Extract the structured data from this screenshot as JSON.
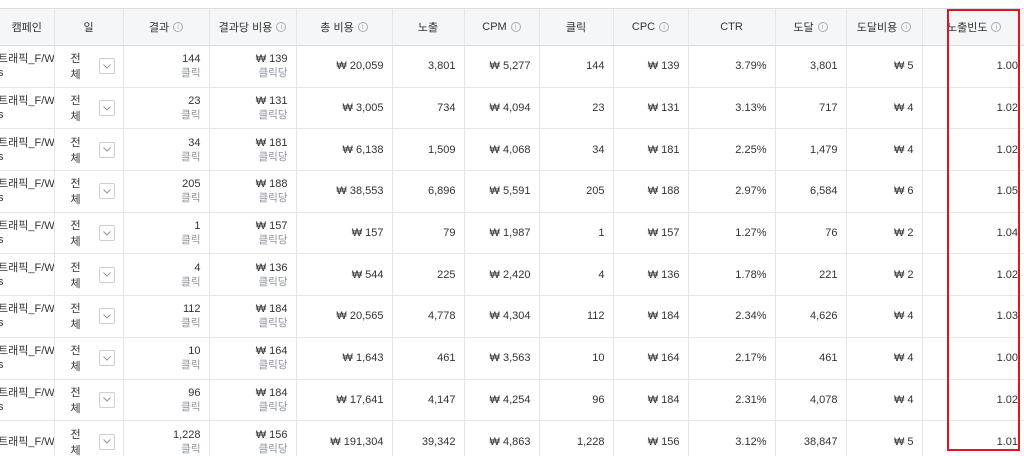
{
  "columns": [
    {
      "label": "캠페인",
      "info": false
    },
    {
      "label": "일",
      "info": false
    },
    {
      "label": "결과",
      "info": true
    },
    {
      "label": "결과당 비용",
      "info": true
    },
    {
      "label": "총 비용",
      "info": true
    },
    {
      "label": "노출",
      "info": false
    },
    {
      "label": "CPM",
      "info": true
    },
    {
      "label": "클릭",
      "info": false
    },
    {
      "label": "CPC",
      "info": true
    },
    {
      "label": "CTR",
      "info": false
    },
    {
      "label": "도달",
      "info": true
    },
    {
      "label": "도달비용",
      "info": true
    },
    {
      "label": "노출빈도",
      "info": true
    }
  ],
  "info_glyph": "i",
  "day_select_value": "전체",
  "result_unit": "클릭",
  "cost_per_result_unit": "클릭당",
  "rows": [
    {
      "campaign": "트래픽_F/W",
      "campaign_sub": "s",
      "results": "144",
      "cost_per_result": "₩ 139",
      "total_cost": "₩ 20,059",
      "impressions": "3,801",
      "cpm": "₩ 5,277",
      "clicks": "144",
      "cpc": "₩ 139",
      "ctr": "3.79%",
      "reach": "3,801",
      "reach_cost": "₩ 5",
      "frequency": "1.00"
    },
    {
      "campaign": "트래픽_F/W",
      "campaign_sub": "s",
      "results": "23",
      "cost_per_result": "₩ 131",
      "total_cost": "₩ 3,005",
      "impressions": "734",
      "cpm": "₩ 4,094",
      "clicks": "23",
      "cpc": "₩ 131",
      "ctr": "3.13%",
      "reach": "717",
      "reach_cost": "₩ 4",
      "frequency": "1.02"
    },
    {
      "campaign": "트래픽_F/W",
      "campaign_sub": "s",
      "results": "34",
      "cost_per_result": "₩ 181",
      "total_cost": "₩ 6,138",
      "impressions": "1,509",
      "cpm": "₩ 4,068",
      "clicks": "34",
      "cpc": "₩ 181",
      "ctr": "2.25%",
      "reach": "1,479",
      "reach_cost": "₩ 4",
      "frequency": "1.02"
    },
    {
      "campaign": "트래픽_F/W",
      "campaign_sub": "s",
      "results": "205",
      "cost_per_result": "₩ 188",
      "total_cost": "₩ 38,553",
      "impressions": "6,896",
      "cpm": "₩ 5,591",
      "clicks": "205",
      "cpc": "₩ 188",
      "ctr": "2.97%",
      "reach": "6,584",
      "reach_cost": "₩ 6",
      "frequency": "1.05"
    },
    {
      "campaign": "트래픽_F/W",
      "campaign_sub": "s",
      "results": "1",
      "cost_per_result": "₩ 157",
      "total_cost": "₩ 157",
      "impressions": "79",
      "cpm": "₩ 1,987",
      "clicks": "1",
      "cpc": "₩ 157",
      "ctr": "1.27%",
      "reach": "76",
      "reach_cost": "₩ 2",
      "frequency": "1.04"
    },
    {
      "campaign": "트래픽_F/W",
      "campaign_sub": "s",
      "results": "4",
      "cost_per_result": "₩ 136",
      "total_cost": "₩ 544",
      "impressions": "225",
      "cpm": "₩ 2,420",
      "clicks": "4",
      "cpc": "₩ 136",
      "ctr": "1.78%",
      "reach": "221",
      "reach_cost": "₩ 2",
      "frequency": "1.02"
    },
    {
      "campaign": "트래픽_F/W",
      "campaign_sub": "s",
      "results": "112",
      "cost_per_result": "₩ 184",
      "total_cost": "₩ 20,565",
      "impressions": "4,778",
      "cpm": "₩ 4,304",
      "clicks": "112",
      "cpc": "₩ 184",
      "ctr": "2.34%",
      "reach": "4,626",
      "reach_cost": "₩ 4",
      "frequency": "1.03"
    },
    {
      "campaign": "트래픽_F/W",
      "campaign_sub": "s",
      "results": "10",
      "cost_per_result": "₩ 164",
      "total_cost": "₩ 1,643",
      "impressions": "461",
      "cpm": "₩ 3,563",
      "clicks": "10",
      "cpc": "₩ 164",
      "ctr": "2.17%",
      "reach": "461",
      "reach_cost": "₩ 4",
      "frequency": "1.00"
    },
    {
      "campaign": "트래픽_F/W",
      "campaign_sub": "s",
      "results": "96",
      "cost_per_result": "₩ 184",
      "total_cost": "₩ 17,641",
      "impressions": "4,147",
      "cpm": "₩ 4,254",
      "clicks": "96",
      "cpc": "₩ 184",
      "ctr": "2.31%",
      "reach": "4,078",
      "reach_cost": "₩ 4",
      "frequency": "1.02"
    },
    {
      "campaign": "트래픽_F/W",
      "campaign_sub": "",
      "results": "1,228",
      "cost_per_result": "₩ 156",
      "total_cost": "₩ 191,304",
      "impressions": "39,342",
      "cpm": "₩ 4,863",
      "clicks": "1,228",
      "cpc": "₩ 156",
      "ctr": "3.12%",
      "reach": "38,847",
      "reach_cost": "₩ 5",
      "frequency": "1.01"
    }
  ],
  "highlight_color": "#e0161e",
  "header_bg": "#f5f6f7",
  "border_color": "#e4e6e9",
  "secondary_text_color": "#8d949e"
}
